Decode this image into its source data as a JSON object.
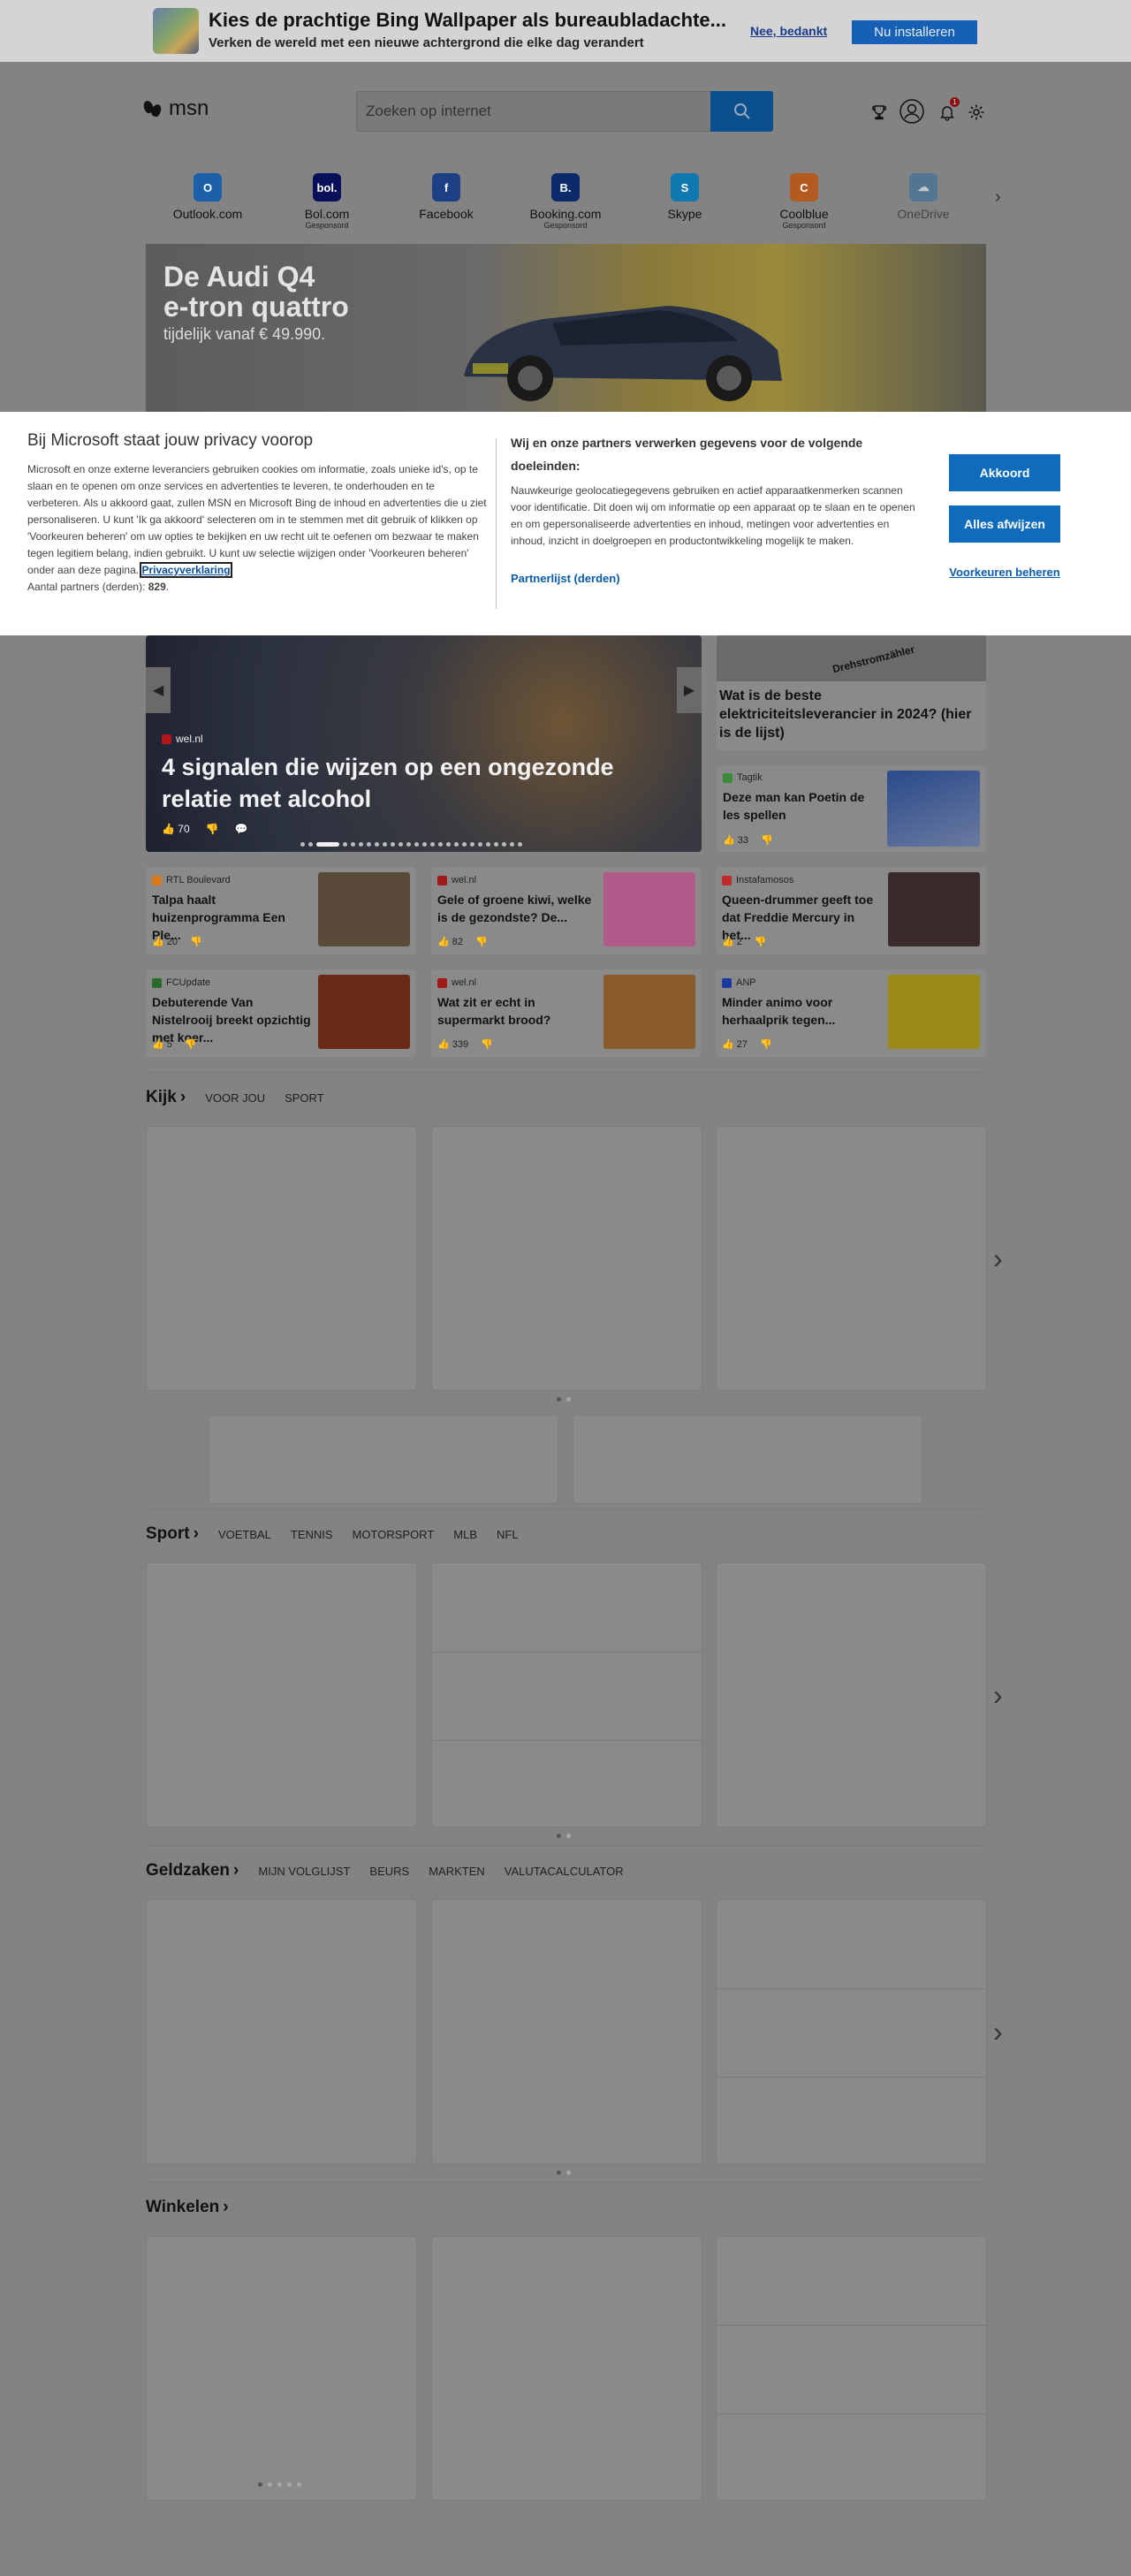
{
  "banner": {
    "title": "Kies de prachtige Bing Wallpaper als bureaubladachte...",
    "subtitle": "Verken de wereld met een nieuwe achtergrond die elke dag verandert",
    "decline": "Nee, bedankt",
    "install": "Nu installeren"
  },
  "header": {
    "logo": "msn",
    "search_placeholder": "Zoeken op internet",
    "icons": [
      "trophy-icon",
      "account-icon",
      "notifications-icon",
      "settings-icon"
    ],
    "notification_count": "1"
  },
  "quicklinks": [
    {
      "label": "Outlook.com",
      "sponsored": "",
      "color": "#1a5fa8",
      "glyph": "O"
    },
    {
      "label": "Bol.com",
      "sponsored": "Gesponsord",
      "color": "#0a0f5a",
      "glyph": "bol."
    },
    {
      "label": "Facebook",
      "sponsored": "",
      "color": "#1c3f86",
      "glyph": "f"
    },
    {
      "label": "Booking.com",
      "sponsored": "Gesponsord",
      "color": "#0a2a6a",
      "glyph": "B."
    },
    {
      "label": "Skype",
      "sponsored": "",
      "color": "#0f78b0",
      "glyph": "S"
    },
    {
      "label": "Coolblue",
      "sponsored": "Gesponsord",
      "color": "#b35a20",
      "glyph": "C"
    },
    {
      "label": "OneDrive",
      "sponsored": "",
      "color": "#2a6aa0",
      "glyph": "☁"
    }
  ],
  "ad": {
    "line1": "De Audi Q4",
    "line2": "e-tron quattro",
    "line3": "tijdelijk vanaf € 49.990."
  },
  "cookie": {
    "title": "Bij Microsoft staat jouw privacy voorop",
    "left_text": "Microsoft en onze externe leveranciers gebruiken cookies om informatie, zoals unieke id's, op te slaan en te openen om onze services en advertenties te leveren, te onderhouden en te verbeteren. Als u akkoord gaat, zullen MSN en Microsoft Bing de inhoud en advertenties die u ziet personaliseren. U kunt 'Ik ga akkoord' selecteren om in te stemmen met dit gebruik of klikken op 'Voorkeuren beheren' om uw opties te bekijken en uw recht uit te oefenen om bezwaar te maken tegen legitiem belang, indien gebruikt. U kunt uw selectie wijzigen onder 'Voorkeuren beheren' onder aan deze pagina.",
    "privacy_link": "Privacyverklaring",
    "partners_label": "Aantal partners (derden):",
    "partners_count": "829",
    "right_heading": "Wij en onze partners verwerken gegevens voor de volgende doeleinden:",
    "right_text": "Nauwkeurige geolocatiegegevens gebruiken en actief apparaatkenmerken scannen voor identificatie. Dit doen wij om informatie op een apparaat op te slaan en te openen en om gepersonaliseerde advertenties en inhoud, metingen voor advertenties en inhoud, inzicht in doelgroepen en productontwikkeling mogelijk te maken.",
    "partner_list": "Partnerlijst (derden)",
    "accept": "Akkoord",
    "reject": "Alles afwijzen",
    "prefs": "Voorkeuren beheren"
  },
  "hero": {
    "source": "wel.nl",
    "title": "4 signalen die wijzen op een ongezonde relatie met alcohol",
    "likes": "70",
    "slides": 26,
    "active_slide": 2
  },
  "side_top": {
    "title": "Wat is de beste elektriciteitsleverancier in 2024? (hier is de lijst)",
    "image_text": "Drehstromzähler"
  },
  "side_card": {
    "source": "Tagtik",
    "title": "Deze man kan Poetin de les spellen",
    "likes": "33"
  },
  "news": [
    {
      "source": "RTL Boulevard",
      "title": "Talpa haalt huizenprogramma Een Ple...",
      "likes": "20",
      "src_color": "#d87a1a",
      "thumb": "#5a4a3a"
    },
    {
      "source": "wel.nl",
      "title": "Gele of groene kiwi, welke is de gezondste? De...",
      "likes": "82",
      "src_color": "#a01a1a",
      "thumb": "#b05a8a"
    },
    {
      "source": "Instafamosos",
      "title": "Queen-drummer geeft toe dat Freddie Mercury in het...",
      "likes": "2",
      "src_color": "#c02a2a",
      "thumb": "#3a2a2a"
    },
    {
      "source": "FCUpdate",
      "title": "Debuterende Van Nistelrooij breekt opzichtig met koer...",
      "likes": "5",
      "src_color": "#2a6a2a",
      "thumb": "#6a2a1a"
    },
    {
      "source": "wel.nl",
      "title": "Wat zit er echt in supermarkt brood?",
      "likes": "339",
      "src_color": "#a01a1a",
      "thumb": "#8a5a2a"
    },
    {
      "source": "ANP",
      "title": "Minder animo voor herhaalprik tegen...",
      "likes": "27",
      "src_color": "#1a3aa0",
      "thumb": "#9a8a1a"
    }
  ],
  "sections": [
    {
      "title": "Kijk",
      "tabs": [
        "VOOR JOU",
        "SPORT"
      ]
    },
    {
      "title": "Sport",
      "tabs": [
        "VOETBAL",
        "TENNIS",
        "MOTORSPORT",
        "MLB",
        "NFL"
      ]
    },
    {
      "title": "Geldzaken",
      "tabs": [
        "MIJN VOLGLIJST",
        "BEURS",
        "MARKTEN",
        "VALUTACALCULATOR"
      ]
    },
    {
      "title": "Winkelen",
      "tabs": []
    }
  ]
}
